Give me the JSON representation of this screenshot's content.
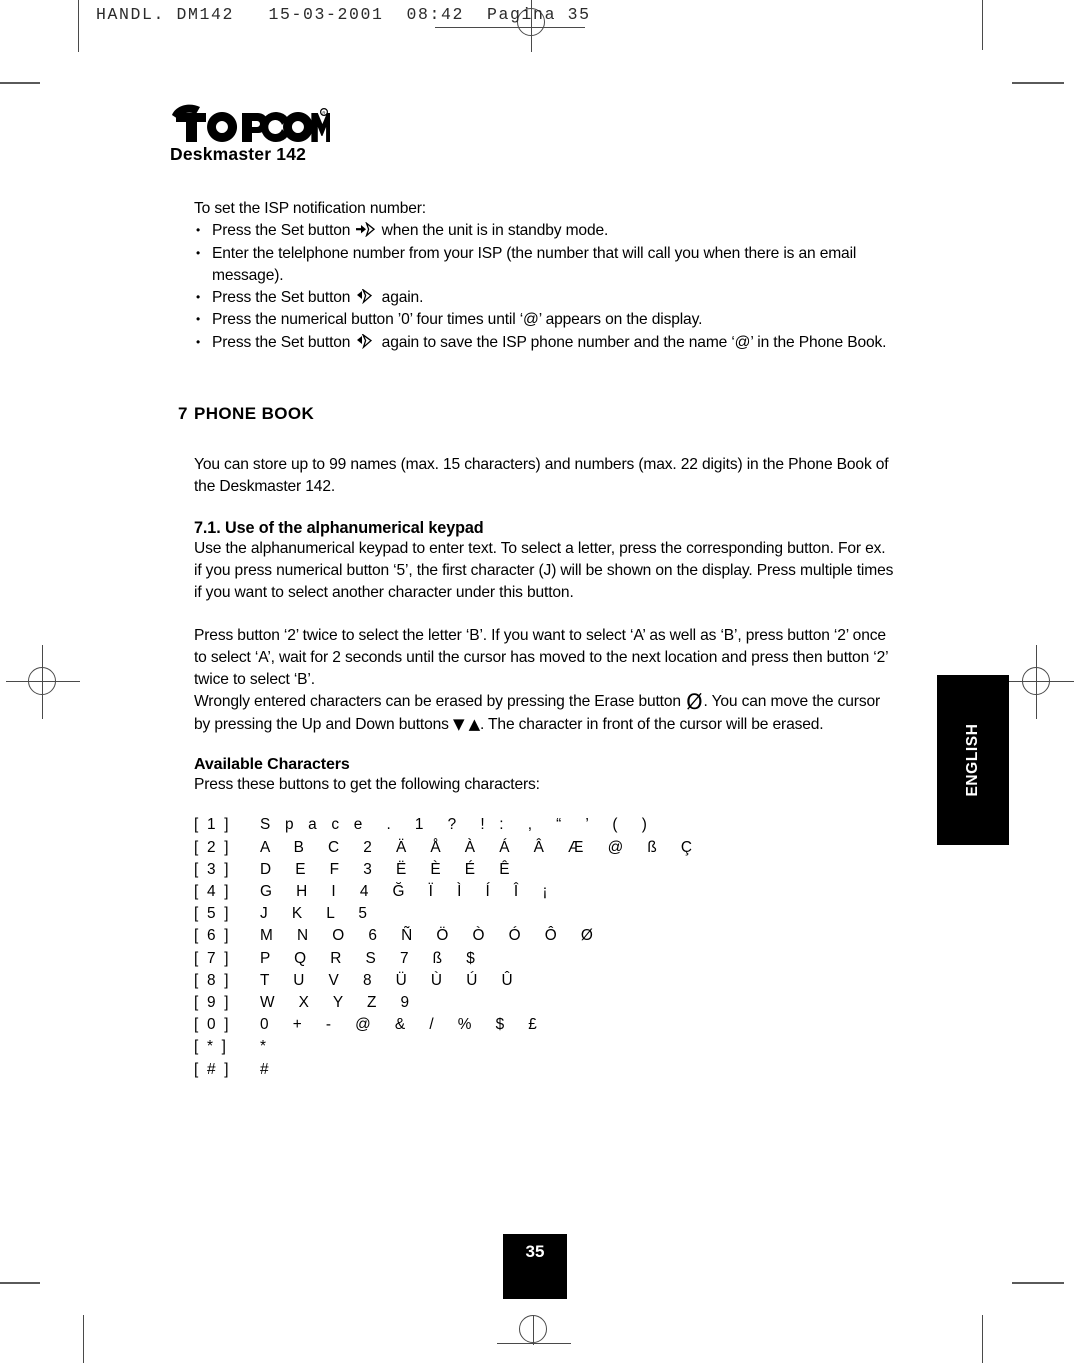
{
  "print_header": {
    "text": "HANDL. DM142   15-03-2001  08:42  Pagina 35"
  },
  "brand": {
    "wordmark": "TOPCOM",
    "registered_mark": "®",
    "model": "Deskmaster 142"
  },
  "intro": {
    "lead": "To set the ISP notification number:",
    "bullets": [
      {
        "before": "Press the Set button",
        "icon": "set-button-icon",
        "after": "when the unit is in standby mode."
      },
      {
        "before": "Enter the telelphone number from your ISP (the number that will call you when there is an email message).",
        "icon": null,
        "after": ""
      },
      {
        "before": "Press the Set button",
        "icon": "set-button-icon",
        "after": "again."
      },
      {
        "before": "Press the numerical button ’0’ four times until ‘@’ appears on the display.",
        "icon": null,
        "after": ""
      },
      {
        "before": "Press the Set button",
        "icon": "set-button-icon",
        "after": "again to save the ISP phone number and the name ‘@’ in the Phone Book."
      }
    ]
  },
  "section": {
    "number": "7",
    "title": "PHONE BOOK",
    "body": "You can store up to 99 names (max. 15 characters) and numbers (max. 22 digits) in the Phone Book of the Deskmaster 142."
  },
  "subsection": {
    "title": "7.1. Use of the alphanumerical keypad",
    "paragraph1": "Use the alphanumerical keypad to enter text. To select a letter, press the corresponding button. For ex. if you press numerical button ‘5’, the first character (J) will be shown on the display. Press multiple times if you want to select another character under this button.",
    "paragraph2": "Press button ‘2’ twice to select the letter ‘B’. If you want to select ‘A’ as well as ‘B’, press button ‘2’ once to select ‘A’, wait for 2 seconds until the cursor has moved to the next location and press then button ‘2’ twice to select ‘B’.",
    "paragraph3_part1": "Wrongly entered characters can be erased by pressing the Erase button",
    "erase_icon_glyph": "Ø",
    "paragraph3_part2": ". You can move the cursor by pressing the Up and Down buttons",
    "down_icon_glyph": "▼",
    "up_icon_glyph": "▲",
    "paragraph3_part3": ". The character in front of the cursor will be erased."
  },
  "characters": {
    "heading": "Available Characters",
    "intro": "Press these buttons to get the following characters:",
    "rows": [
      {
        "key": "[ 1 ]",
        "values": "S p a c e  .  1  ?  ! :  ,  “  ’  (  )"
      },
      {
        "key": "[ 2 ]",
        "values": "A  B  C  2  Ä  Å  À  Á  Â  Æ  @  ß  Ç"
      },
      {
        "key": "[ 3 ]",
        "values": "D  E  F  3  Ë  È  É  Ê"
      },
      {
        "key": "[ 4 ]",
        "values": "G  H  I  4  Ğ  Ï  Ì  Í  Î  ¡"
      },
      {
        "key": "[ 5 ]",
        "values": "J  K  L  5"
      },
      {
        "key": "[ 6 ]",
        "values": "M  N  O  6  Ñ  Ö  Ò  Ó  Ô  Ø"
      },
      {
        "key": "[ 7 ]",
        "values": "P  Q  R  S  7  ß  $"
      },
      {
        "key": "[ 8 ]",
        "values": "T  U  V  8  Ü  Ù  Ú  Û"
      },
      {
        "key": "[ 9 ]",
        "values": "W  X  Y  Z  9"
      },
      {
        "key": "[ 0 ]",
        "values": "0  +  -  @  &  /  %  $  £"
      },
      {
        "key": "[ * ]",
        "values": "*"
      },
      {
        "key": "[ # ]",
        "values": "#"
      }
    ]
  },
  "side_tab": {
    "label": "ENGLISH"
  },
  "footer": {
    "page_number": "35"
  },
  "colors": {
    "ink": "#000000",
    "paper": "#ffffff",
    "crop_mark": "#4a4a4a"
  }
}
